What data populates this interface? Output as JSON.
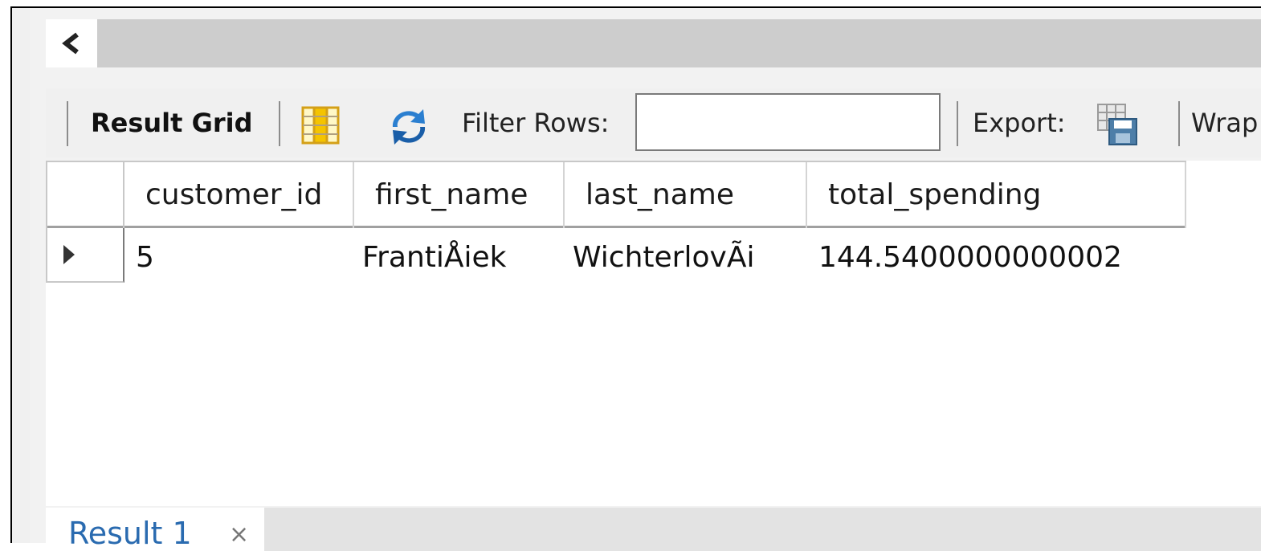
{
  "scroll": {
    "left_arrow": "<"
  },
  "toolbar": {
    "result_grid_label": "Result Grid",
    "filter_rows_label": "Filter Rows:",
    "filter_value": "",
    "export_label": "Export:",
    "wrap_label": "Wrap"
  },
  "grid": {
    "columns": [
      "customer_id",
      "first_name",
      "last_name",
      "total_spending"
    ],
    "rows": [
      {
        "customer_id": "5",
        "first_name": "FrantiÅiek",
        "last_name": "WichterlovÃi",
        "total_spending": "144.5400000000002"
      }
    ]
  },
  "tabs": [
    {
      "label": "Result 1",
      "close": "×"
    }
  ],
  "colors": {
    "tab_text": "#2a6bb0",
    "scroll_track": "#cdcdcd"
  }
}
